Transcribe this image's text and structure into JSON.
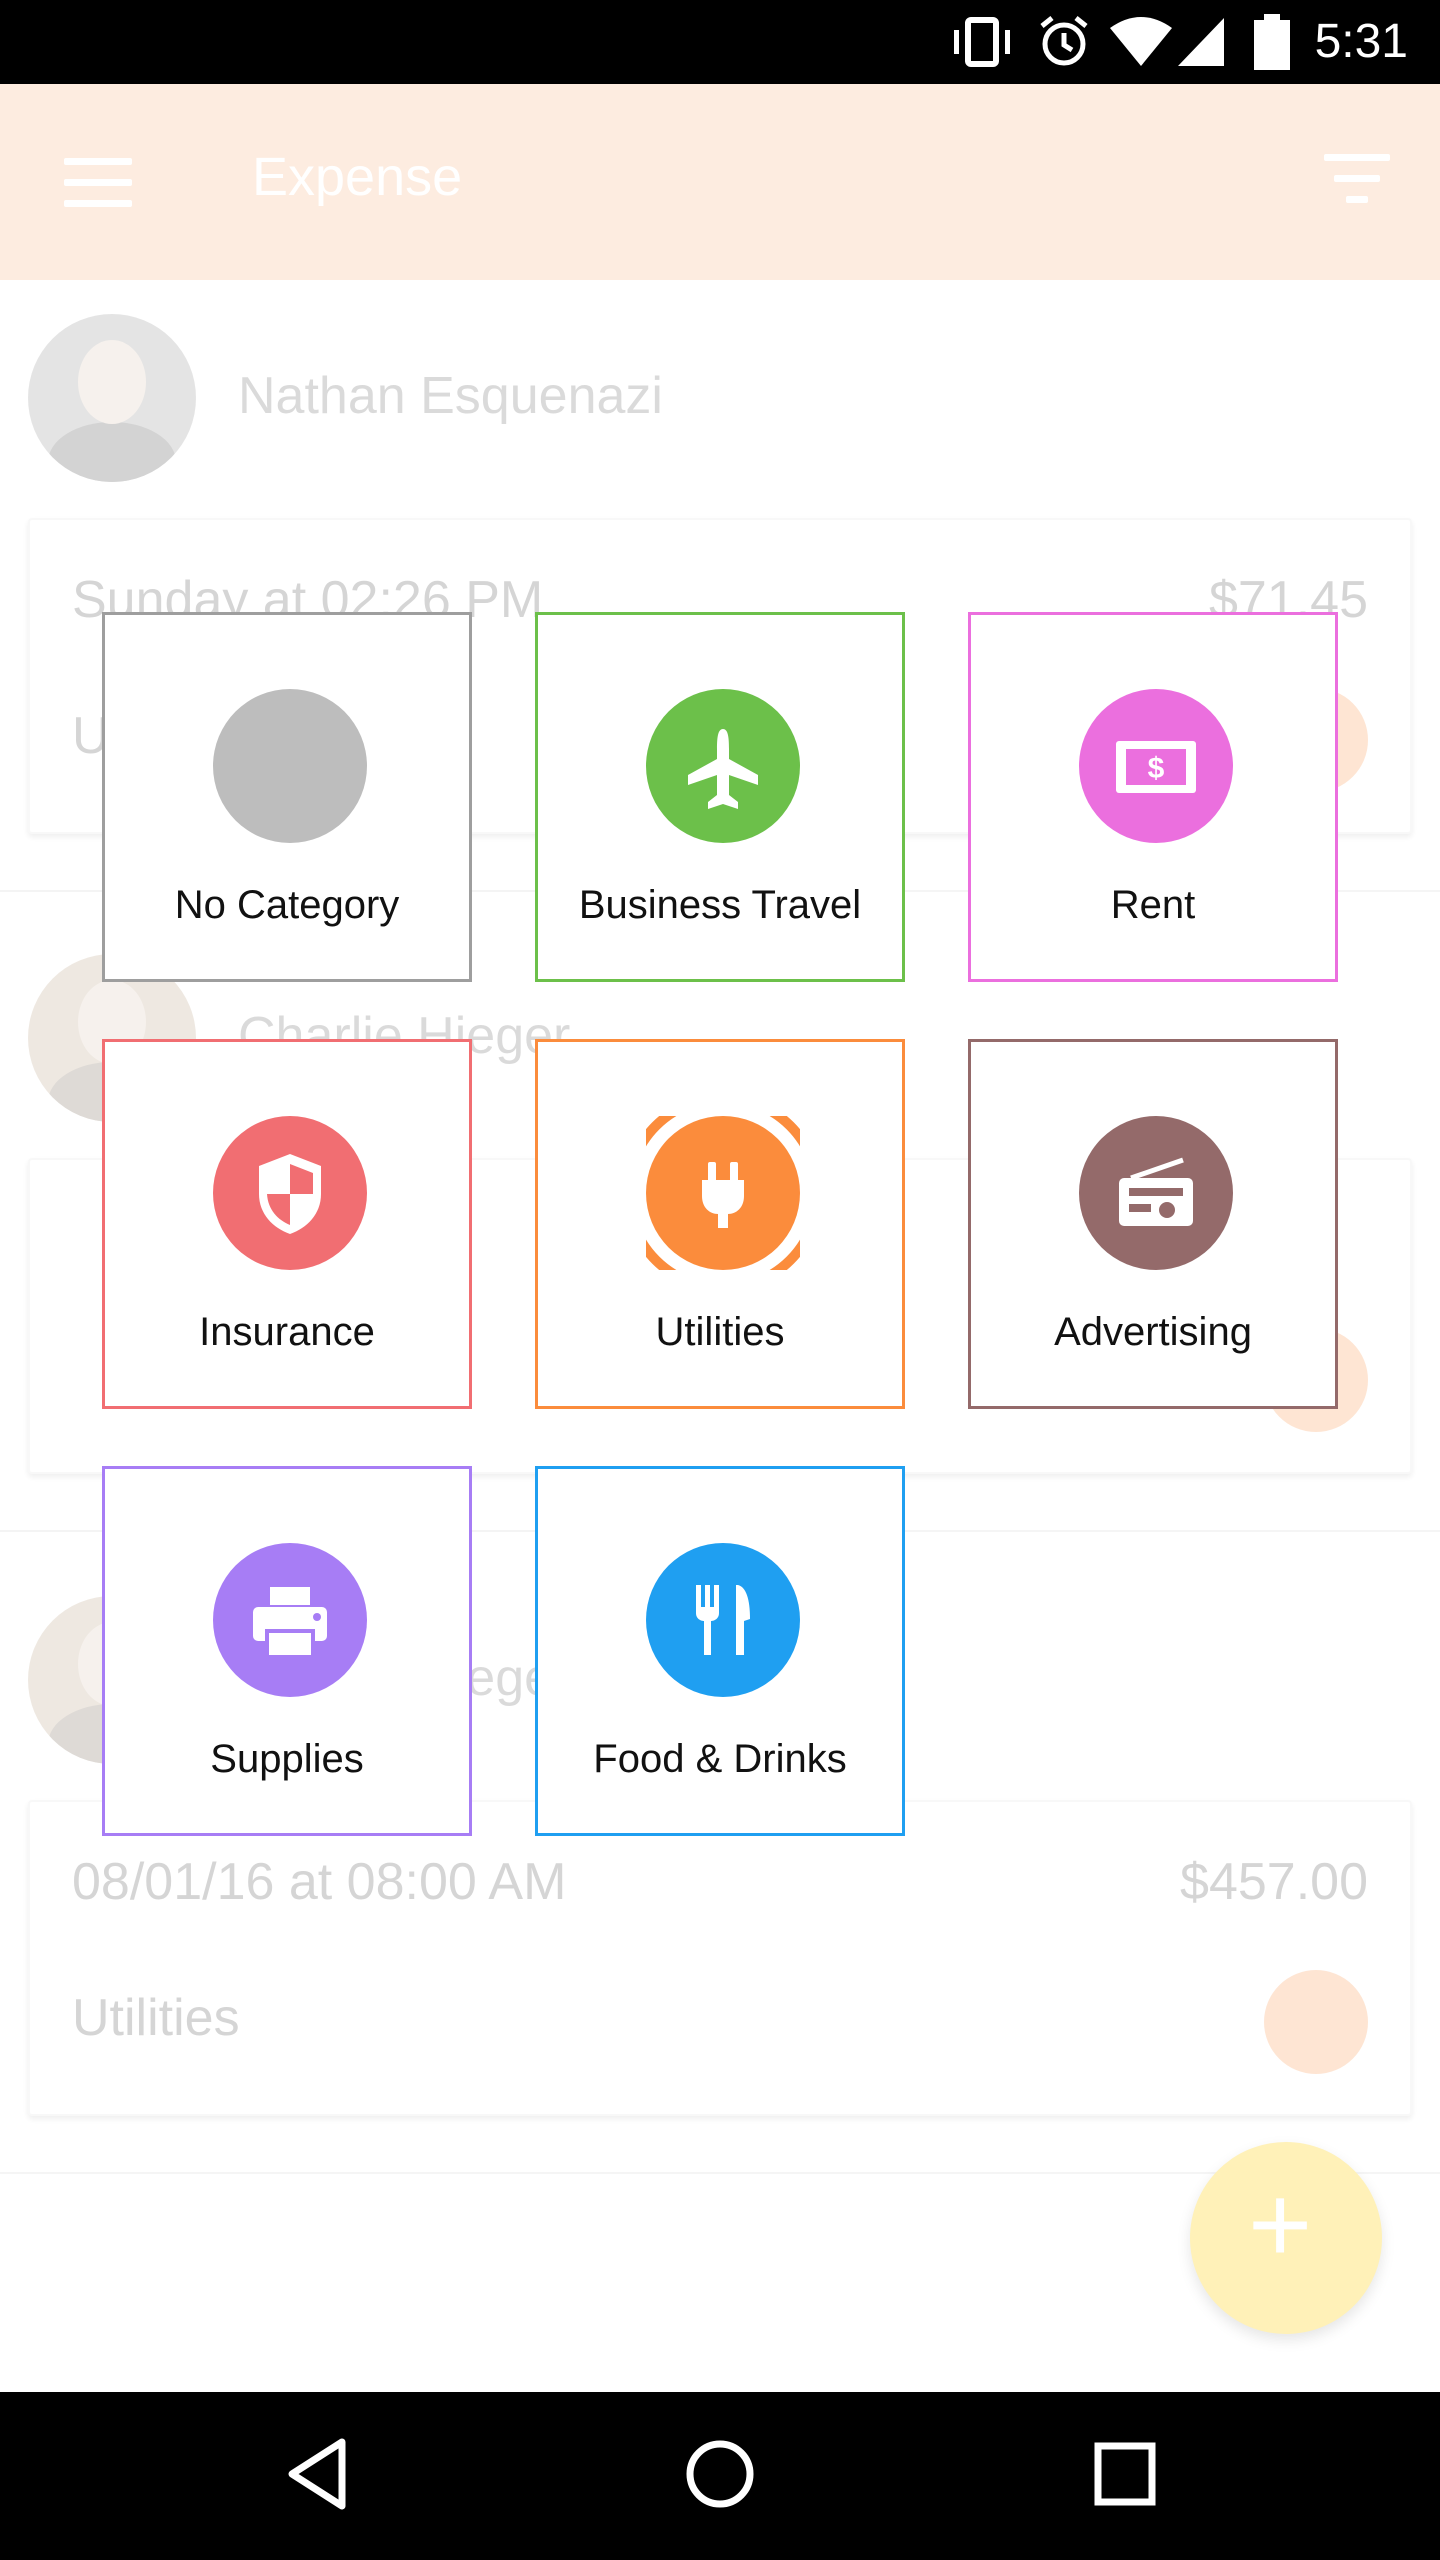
{
  "status_bar": {
    "time": "5:31"
  },
  "app_bar": {
    "title": "Expense"
  },
  "background": {
    "users": [
      {
        "name": "Nathan Esquenazi"
      },
      {
        "name": "Charlie Hieger"
      },
      {
        "name": "Charlie Hieger"
      }
    ],
    "expenses": [
      {
        "date": "Sunday at 02:26 PM",
        "amount": "$71.45",
        "category": "Utilities"
      },
      {
        "date": "08/01/16 at 08:00 AM",
        "amount": "$457.00",
        "category": "Utilities"
      }
    ]
  },
  "categories": [
    {
      "name": "No Category",
      "color": "#bdbdbd",
      "border": "#9e9e9e",
      "icon": "none"
    },
    {
      "name": "Business Travel",
      "color": "#6cc04a",
      "border": "#6cc04a",
      "icon": "airplane-icon"
    },
    {
      "name": "Rent",
      "color": "#eb6fde",
      "border": "#eb6fde",
      "icon": "money-bill-icon"
    },
    {
      "name": "Insurance",
      "color": "#f16e72",
      "border": "#f16e72",
      "icon": "shield-icon"
    },
    {
      "name": "Utilities",
      "color": "#fb8c3c",
      "border": "#fb8c3c",
      "icon": "plug-icon",
      "selected": true
    },
    {
      "name": "Advertising",
      "color": "#946a6a",
      "border": "#946a6a",
      "icon": "radio-icon"
    },
    {
      "name": "Supplies",
      "color": "#a77df5",
      "border": "#a77df5",
      "icon": "printer-icon"
    },
    {
      "name": "Food & Drinks",
      "color": "#1f9ff1",
      "border": "#1f9ff1",
      "icon": "fork-knife-icon"
    }
  ]
}
